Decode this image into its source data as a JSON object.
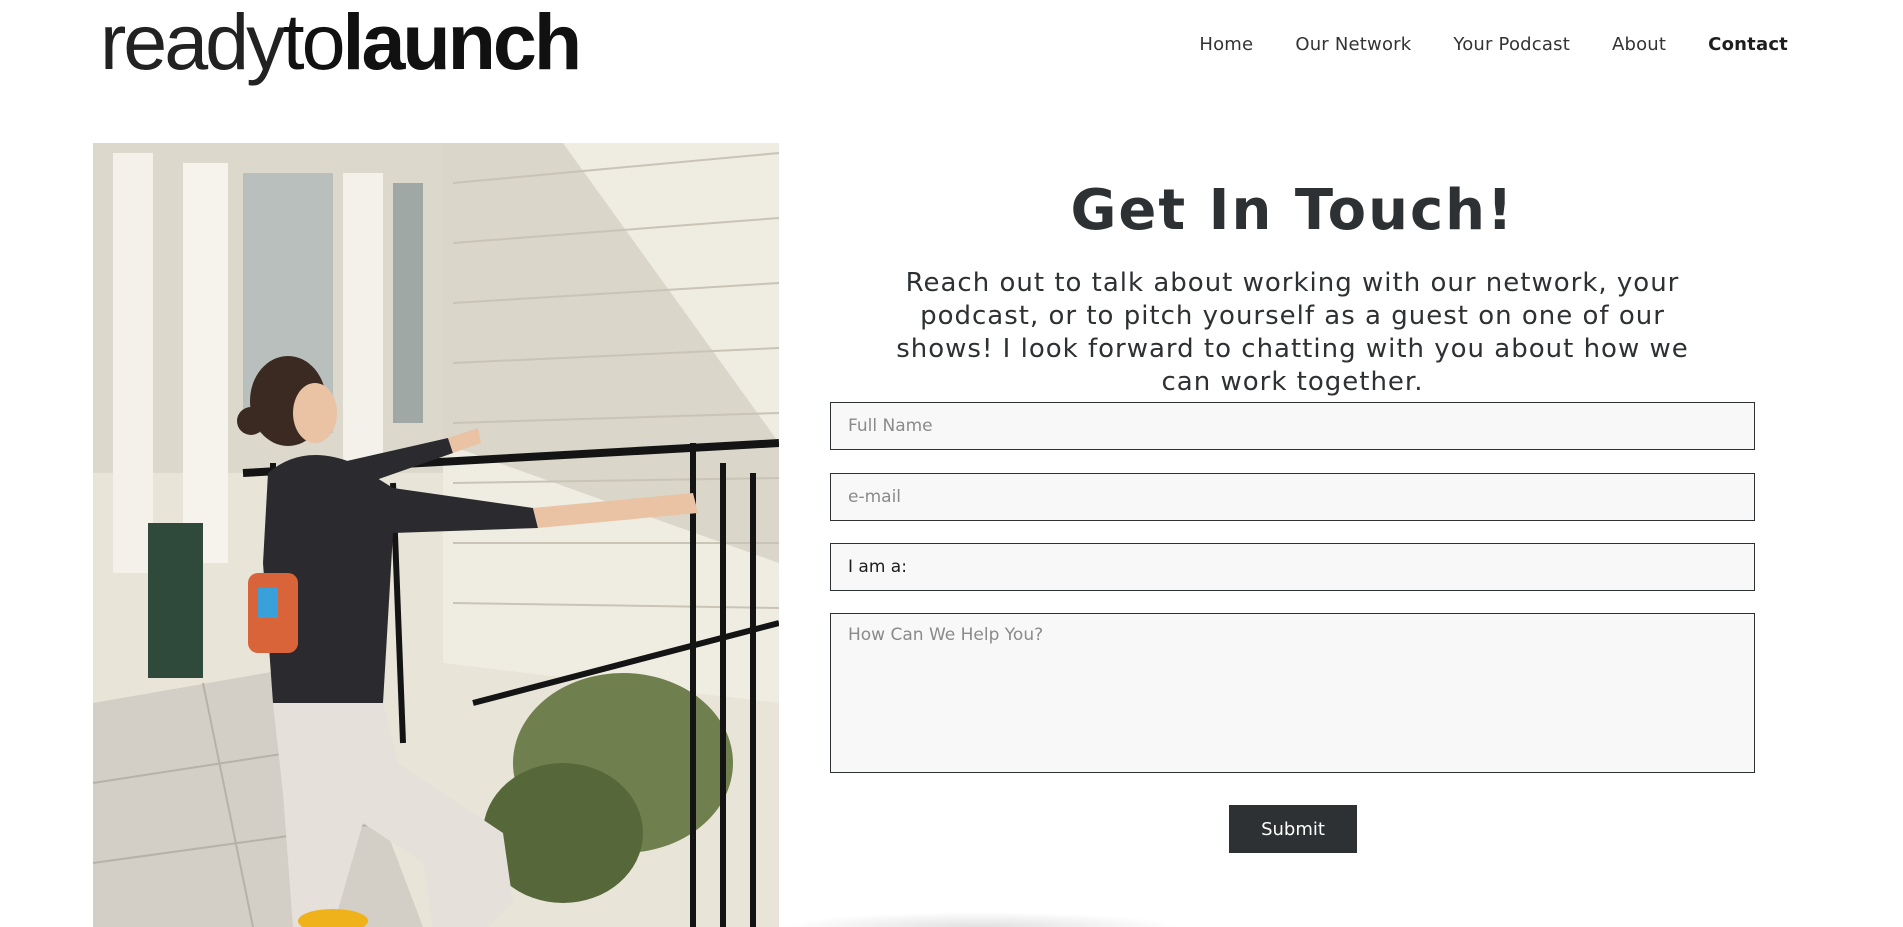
{
  "logo": {
    "part_light": "ready",
    "part_regular": "to",
    "part_bold": "launch"
  },
  "nav": {
    "items": [
      {
        "label": "Home",
        "active": false
      },
      {
        "label": "Our Network",
        "active": false
      },
      {
        "label": "Your Podcast",
        "active": false
      },
      {
        "label": "About",
        "active": false
      },
      {
        "label": "Contact",
        "active": true
      }
    ]
  },
  "contact": {
    "title": "Get In Touch!",
    "intro": "Reach out to talk about working with our network, your podcast, or to pitch yourself as a guest on one of our shows! I look forward to chatting with you about how we can work together.",
    "fields": {
      "full_name_placeholder": "Full Name",
      "email_placeholder": "e-mail",
      "role_select_value": "I am a:",
      "message_placeholder": "How Can We Help You?"
    },
    "submit_label": "Submit"
  },
  "colors": {
    "primary_dark": "#2e3134",
    "field_bg": "#f8f8f8",
    "page_bg": "#ffffff"
  }
}
